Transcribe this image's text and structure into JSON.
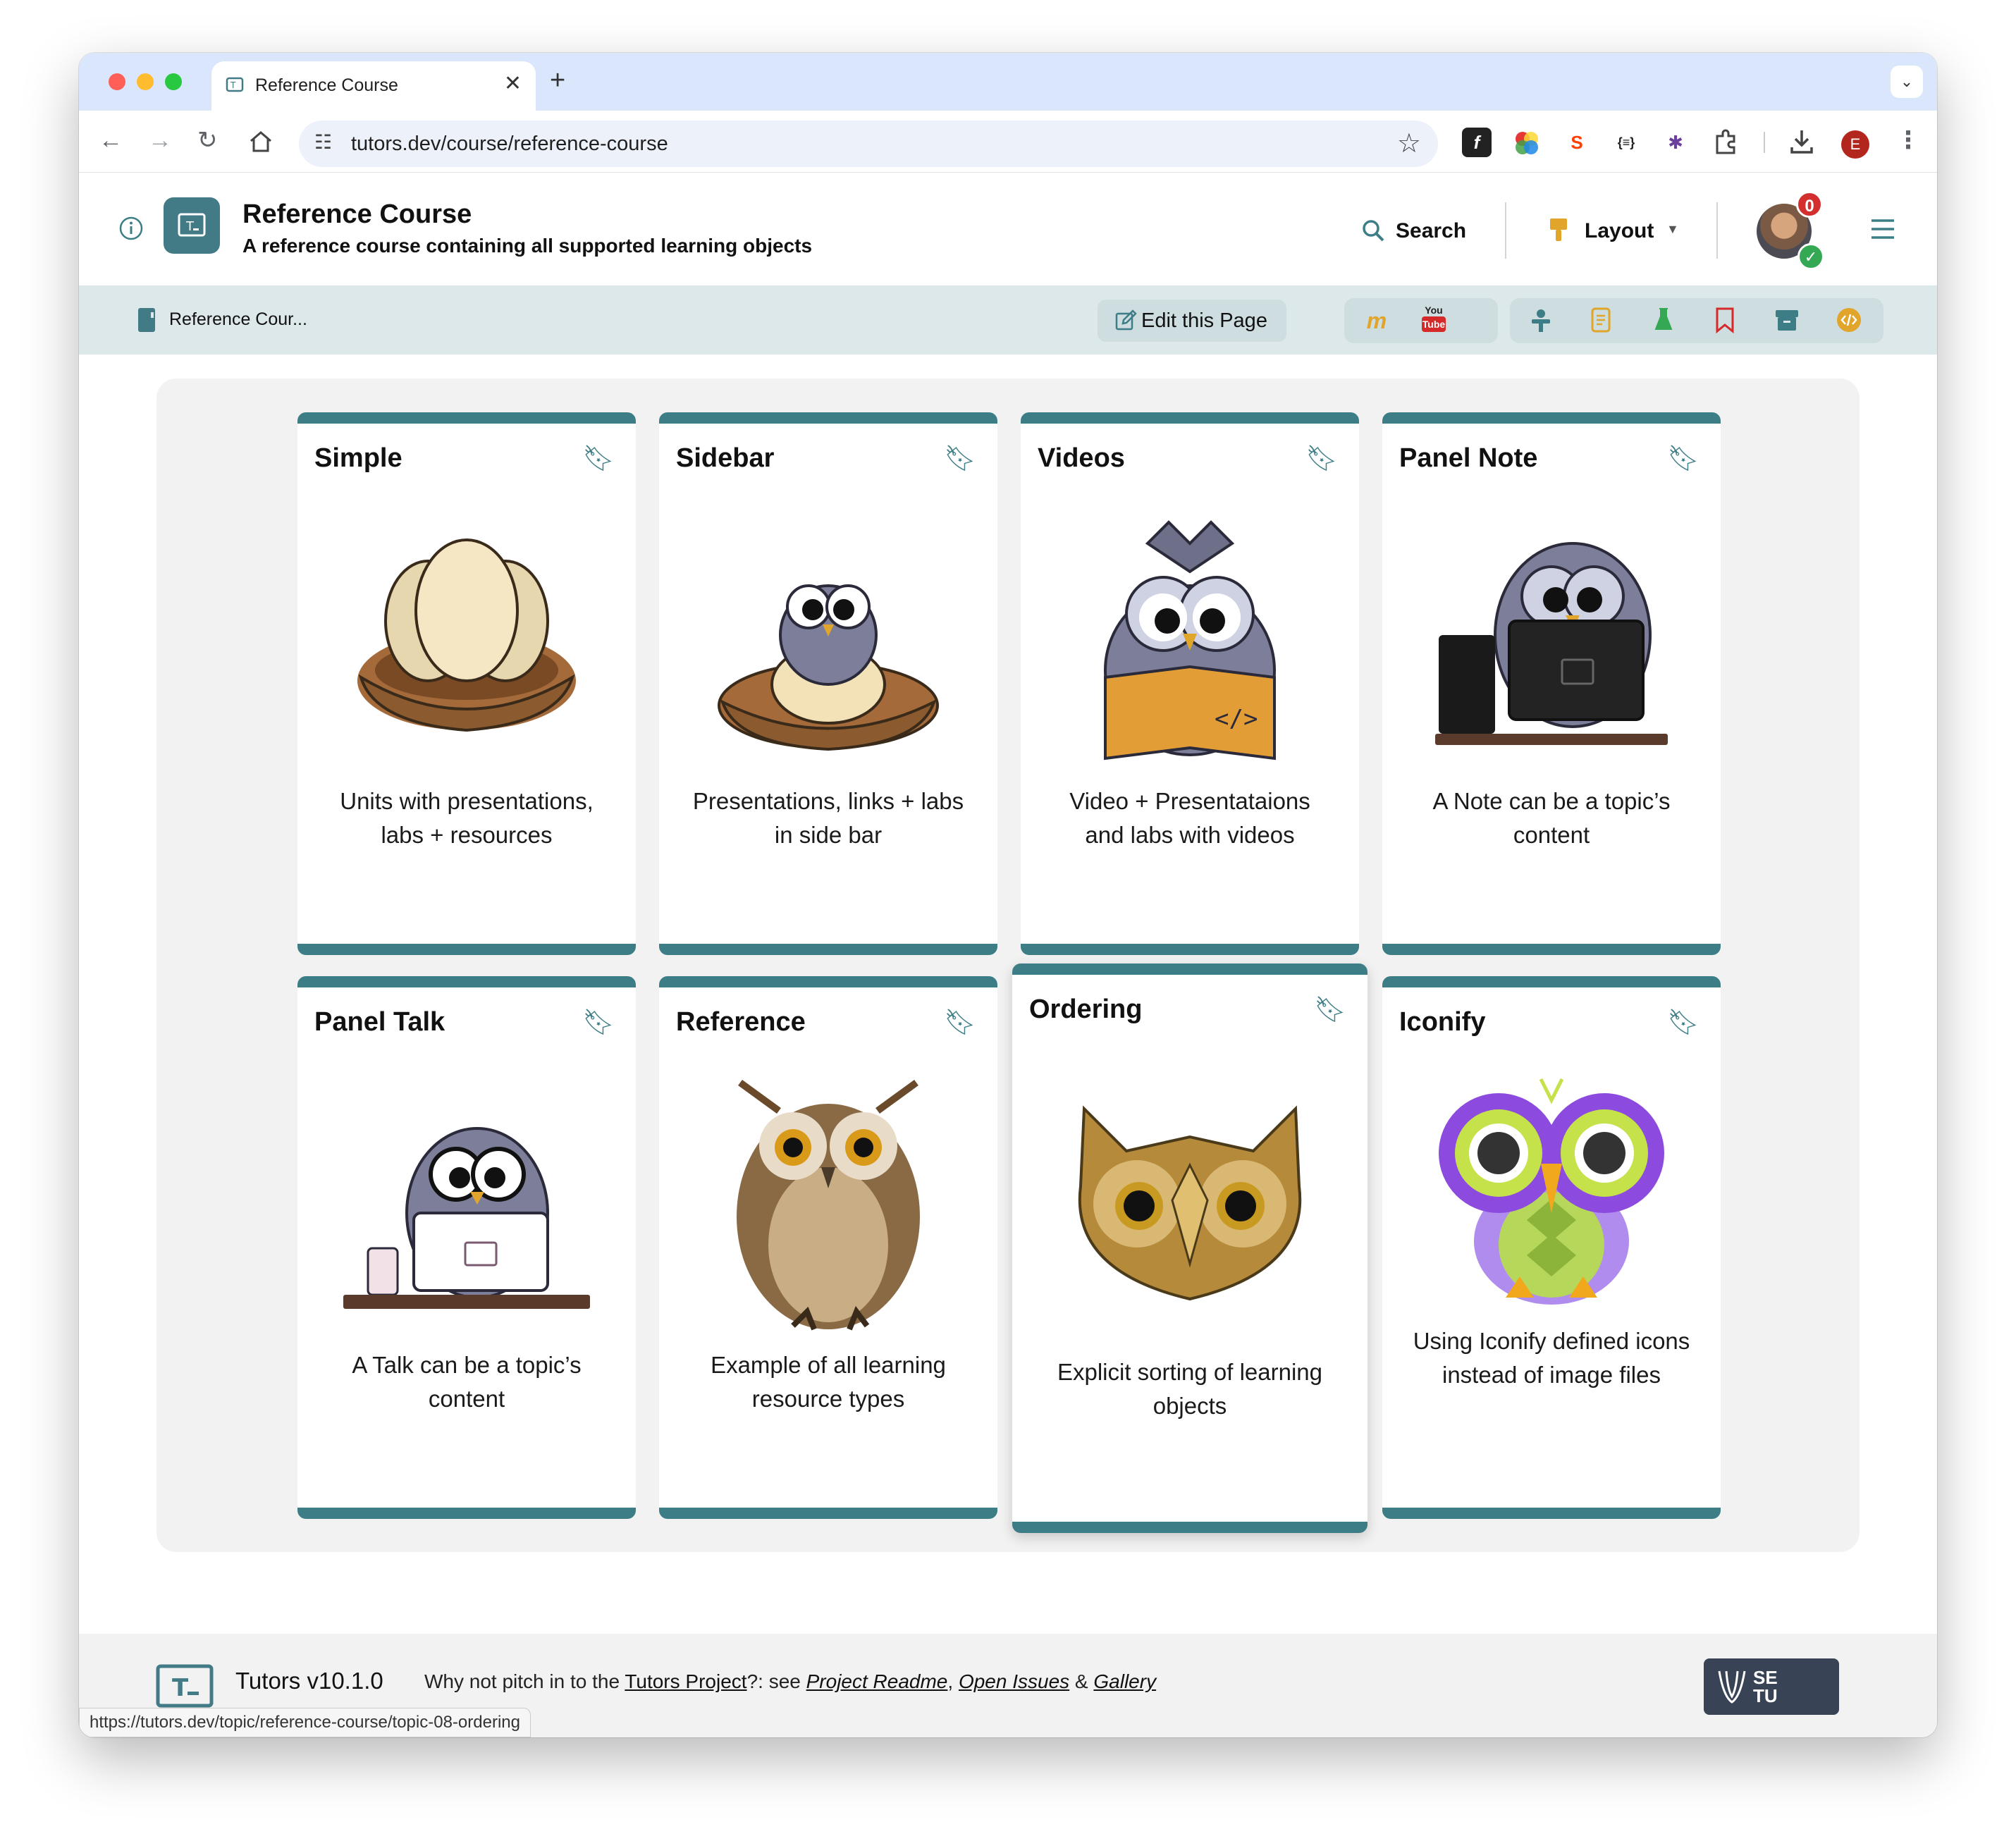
{
  "browser": {
    "tab_title": "Reference Course",
    "tab_close": "✕",
    "new_tab": "+",
    "url": "tutors.dev/course/reference-course",
    "profile_initial": "E",
    "traffic_colors": [
      "#ff5f57",
      "#febc2e",
      "#28c840"
    ]
  },
  "header": {
    "course_title": "Reference Course",
    "course_subtitle": "A reference course containing all supported learning objects",
    "search_label": "Search",
    "layout_label": "Layout",
    "notification_count": "0"
  },
  "subbar": {
    "breadcrumb": "Reference Cour...",
    "edit_label": "Edit this Page",
    "youtube_top": "You",
    "youtube_bottom": "Tube"
  },
  "cards": [
    {
      "title": "Simple",
      "description_line1": "Units with presentations,",
      "description_line2": "labs + resources",
      "image": "eggs-in-nest"
    },
    {
      "title": "Sidebar",
      "description_line1": "Presentations, links + labs",
      "description_line2": "in side bar",
      "image": "owlet-hatching-in-nest"
    },
    {
      "title": "Videos",
      "description_line1": "Video + Presentataions",
      "description_line2": "and labs with videos",
      "image": "owl-reading-code-book"
    },
    {
      "title": "Panel Note",
      "description_line1": "A Note can be a topic’s",
      "description_line2": "content",
      "image": "owl-at-computer"
    },
    {
      "title": "Panel Talk",
      "description_line1": "A Talk can be a topic’s",
      "description_line2": "content",
      "image": "owl-with-laptop"
    },
    {
      "title": "Reference",
      "description_line1": "Example of all learning",
      "description_line2": "resource types",
      "image": "realistic-owl"
    },
    {
      "title": "Ordering",
      "description_line1": "Explicit sorting of learning",
      "description_line2": "objects",
      "image": "golden-owl-face"
    },
    {
      "title": "Iconify",
      "description_line1": "Using Iconify defined icons",
      "description_line2": "instead of image files",
      "image": "green-purple-owl-icon"
    }
  ],
  "footer": {
    "version": "Tutors v10.1.0",
    "text_prefix": "Why not pitch in to the ",
    "link_project": "Tutors Project",
    "text_mid": "?: see ",
    "link_readme": "Project Readme",
    "comma": ", ",
    "link_issues": "Open Issues",
    "amp": " & ",
    "link_gallery": "Gallery",
    "setu_line1": "SE",
    "setu_line2": "TU"
  },
  "status_url": "https://tutors.dev/topic/reference-course/topic-08-ordering",
  "colors": {
    "accent": "#3d7d86",
    "accent_light": "#dde8ea",
    "youtube": "#d62a2a",
    "gold": "#e0a52a"
  }
}
